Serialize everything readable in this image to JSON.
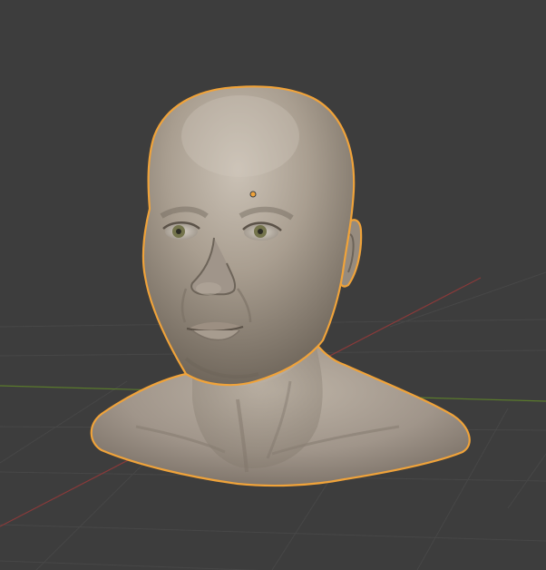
{
  "viewport": {
    "background_color": "#3d3d3d",
    "grid_line_color": "#4a4a4a",
    "x_axis_color": "#8a3b3b",
    "y_axis_color": "#5c7a2a"
  },
  "object": {
    "kind": "sculpted-head-bust",
    "selected": true,
    "selection_outline_color": "#f0a33a",
    "origin_point_color": "#f0a33a",
    "skin_color": "#a59a8c",
    "skin_highlight_color": "#c9c0b4",
    "skin_shadow_color": "#6f665b",
    "iris_color": "#7a7a52"
  }
}
